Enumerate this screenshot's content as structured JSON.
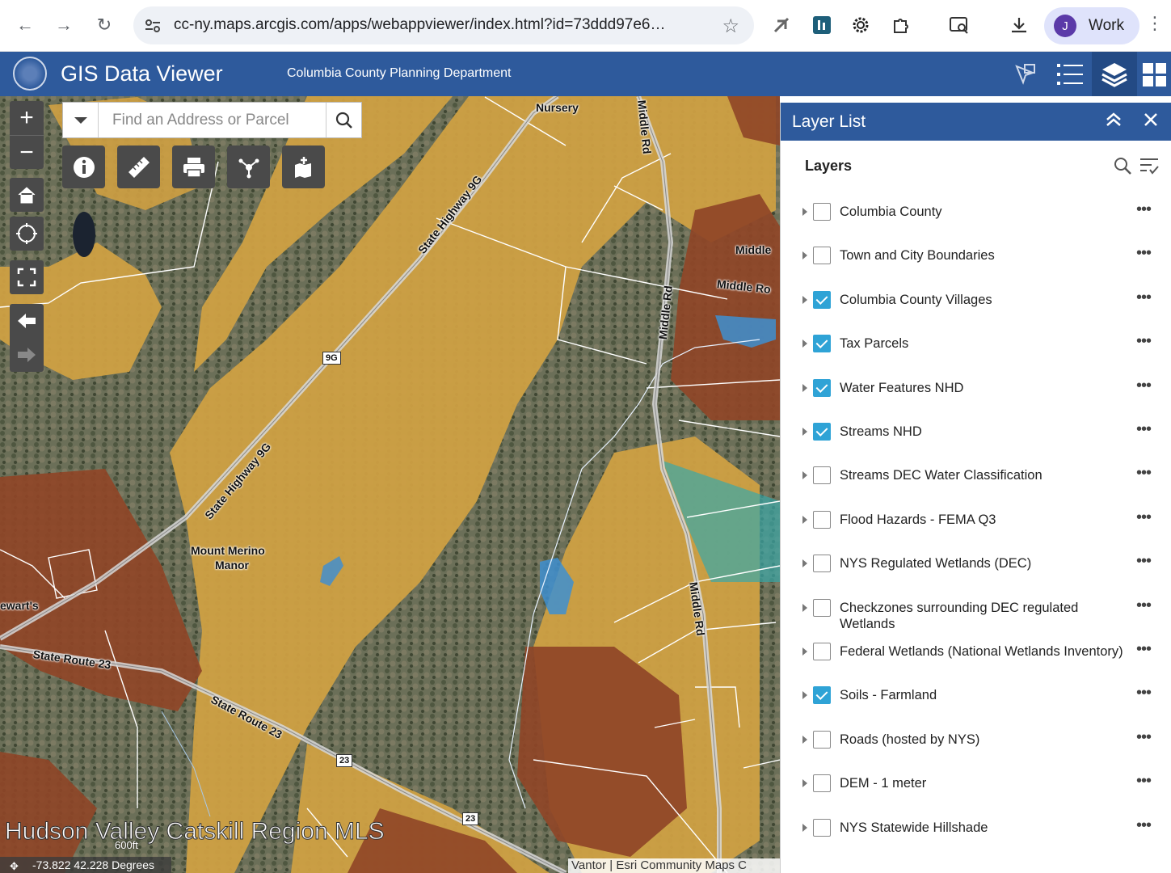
{
  "browser": {
    "url": "cc-ny.maps.arcgis.com/apps/webappviewer/index.html?id=73ddd97e6…",
    "profile_initial": "J",
    "profile_name": "Work"
  },
  "app": {
    "title": "GIS Data Viewer",
    "subtitle": "Columbia County Planning Department"
  },
  "map": {
    "search_placeholder": "Find an Address or Parcel",
    "labels": {
      "nursery": "Nursery",
      "middle_rd": "Middle Rd",
      "middle": "Middle",
      "middle_ro": "Middle Ro",
      "highway_9g": "State Highway 9G",
      "route_23": "State Route 23",
      "manor_line1": "Mount Merino",
      "manor_line2": "Manor",
      "stewarts": "ewart's",
      "shield_9g": "9G",
      "shield_23": "23"
    },
    "watermark": "Hudson Valley Catskill Region MLS",
    "scale_label": "600ft",
    "coordinates": "-73.822 42.228 Degrees",
    "attribution": "Vantor | Esri Community Maps C"
  },
  "panel": {
    "title": "Layer List",
    "section_title": "Layers",
    "layers": [
      {
        "label": "Columbia County",
        "checked": false
      },
      {
        "label": "Town and City Boundaries",
        "checked": false
      },
      {
        "label": "Columbia County Villages",
        "checked": true
      },
      {
        "label": "Tax Parcels",
        "checked": true
      },
      {
        "label": "Water Features NHD",
        "checked": true
      },
      {
        "label": "Streams NHD",
        "checked": true
      },
      {
        "label": "Streams DEC Water Classification",
        "checked": false
      },
      {
        "label": "Flood Hazards - FEMA Q3",
        "checked": false
      },
      {
        "label": "NYS Regulated Wetlands (DEC)",
        "checked": false
      },
      {
        "label": "Checkzones surrounding DEC regulated Wetlands",
        "checked": false
      },
      {
        "label": "Federal Wetlands (National Wetlands Inventory)",
        "checked": false
      },
      {
        "label": "Soils - Farmland",
        "checked": true
      },
      {
        "label": "Roads (hosted by NYS)",
        "checked": false
      },
      {
        "label": "DEM - 1 meter",
        "checked": false
      },
      {
        "label": "NYS Statewide Hillshade",
        "checked": false
      }
    ]
  },
  "colors": {
    "header_blue": "#2e5a9c",
    "soil_gold": "#d6a53c",
    "soil_brown": "#9a4a2a",
    "water_blue": "#3e8fd0",
    "check_blue": "#2fa3d6"
  }
}
